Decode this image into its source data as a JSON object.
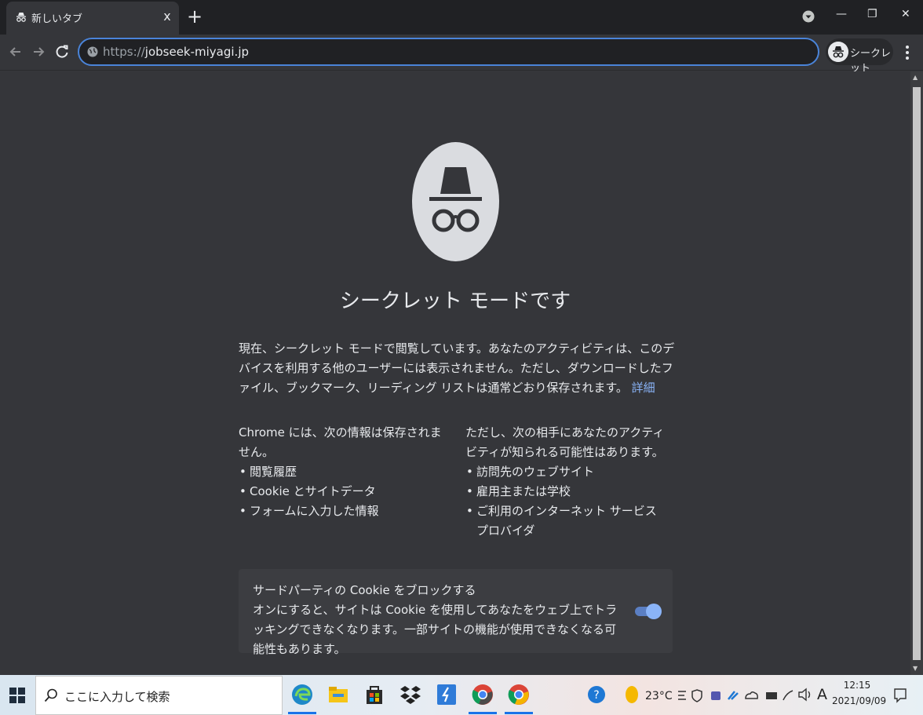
{
  "window": {
    "tab_title": "新しいタブ",
    "tab_close": "x",
    "new_tab": "+",
    "minimize": "—",
    "restore": "❐",
    "close": "✕"
  },
  "toolbar": {
    "url_scheme": "https://",
    "url_host": "jobseek-miyagi.jp",
    "incognito_label": "シークレット"
  },
  "page": {
    "headline": "シークレット モードです",
    "intro": "現在、シークレット モードで閲覧しています。あなたのアクティビティは、このデバイスを利用する他のユーザーには表示されません。ただし、ダウンロードしたファイル、ブックマーク、リーディング リストは通常どおり保存されます。",
    "learn_more": "詳細",
    "not_saved_heading": "Chrome には、次の情報は保存されません。",
    "not_saved_items": [
      "閲覧履歴",
      "Cookie とサイトデータ",
      "フォームに入力した情報"
    ],
    "visible_heading": "ただし、次の相手にあなたのアクティビティが知られる可能性はあります。",
    "visible_items": [
      "訪問先のウェブサイト",
      "雇用主または学校",
      "ご利用のインターネット サービス プロバイダ"
    ],
    "cookie_title": "サードパーティの Cookie をブロックする",
    "cookie_desc": "オンにすると、サイトは Cookie を使用してあなたをウェブ上でトラッキングできなくなります。一部サイトの機能が使用できなくなる可能性もあります。",
    "cookie_toggle_on": true
  },
  "taskbar": {
    "search_placeholder": "ここに入力して検索",
    "weather_temp": "23°C",
    "ime": "A",
    "time": "12:15",
    "date": "2021/09/09"
  },
  "colors": {
    "accent": "#8ab4f8",
    "background": "#35363a",
    "titlebar": "#202124"
  }
}
